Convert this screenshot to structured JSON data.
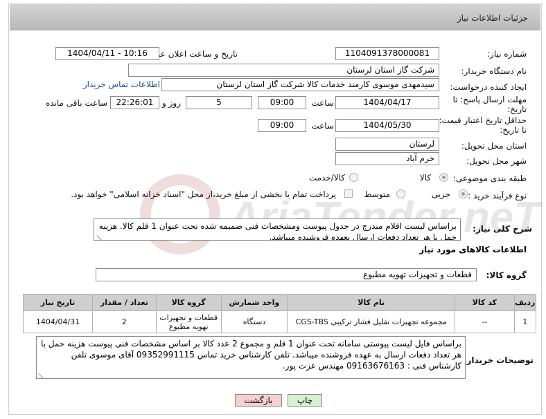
{
  "header": {
    "title": "جزئیات اطلاعات نیاز"
  },
  "form": {
    "need_number_label": "شماره نیاز:",
    "need_number": "1104091378000081",
    "announce_label": "تاریخ و ساعت اعلان عمومی:",
    "announce_value": "1404/04/11 - 10:16",
    "buyer_org_label": "نام دستگاه خریدار:",
    "buyer_org": "شرکت گاز استان لرستان",
    "requester_label": "ایجاد کننده درخواست:",
    "requester": "سیدمهدی موسوی کارمند خدمات کالا شرکت گاز استان لرستان",
    "buyer_contact_link": "اطلاعات تماس خریدار",
    "reply_deadline_label_1": "مهلت ارسال پاسخ: تا",
    "reply_deadline_label_2": "تاریخ:",
    "reply_date": "1404/04/17",
    "time_label": "ساعت",
    "reply_time": "09:00",
    "days_value": "5",
    "days_label": "روز و",
    "remaining_time": "22:26:01",
    "remaining_label": "ساعت باقی مانده",
    "price_validity_label_1": "حداقل تاریخ اعتبار قیمت:",
    "price_validity_label_2": "تا تاریخ:",
    "price_date": "1404/05/30",
    "price_time": "09:00",
    "province_label": "استان محل تحویل:",
    "province": "لرستان",
    "city_label": "شهر محل تحویل:",
    "city": "خرم آباد",
    "category_label": "طبقه بندی موضوعی:",
    "category_options": [
      "کالا",
      "کالا/خدمت"
    ],
    "process_label": "نوع فرآیند خرید :",
    "process_options": [
      "جزیی",
      "متوسط"
    ],
    "payment_note": "پرداخت تمام یا بخشی از مبلغ خرید،از محل \"اسناد خزانه اسلامی\" خواهد بود."
  },
  "summary": {
    "label": "شرح کلی نیاز:",
    "text": "براساس لیست اقلام مندرج در جدول پیوست ومشخصات فنی ضمیمه شده تحت عنوان 1 قلم کالا. هزینه حمل با هر تعداد دفعات ارسال بعهده فروشنده میباشد."
  },
  "goods": {
    "section_title": "اطلاعات کالاهای مورد نیاز",
    "group_label": "گروه کالا:",
    "group_value": "قطعات و تجهیزات تهویه مطبوع",
    "columns": [
      "ردیف",
      "کد کالا",
      "نام کالا",
      "واحد شمارش",
      "گروه کالا",
      "تعداد / مقدار",
      "تاریخ نیاز"
    ],
    "rows": [
      [
        "1",
        "--",
        "مجموعه تجهیزات تقلیل فشار ترکیبی CGS-TBS",
        "دستگاه",
        "قطعات و تجهیزات تهویه مطبوع",
        "2",
        "1404/04/31"
      ]
    ]
  },
  "buyer_notes": {
    "label": "توضیحات خریدار:",
    "text": "براساس  فایل لیست پیوستی سامانه تحت عنوان 1 قلم و مجموع 2 عدد کالا بر اساس مشخصات فنی پیوست هزینه حمل با هر تعداد دفعات ارسال به عهده فروشنده میباشد. تلفن کارشناس خرید تماس 09352991115 آقای موسوی تلفن کارشناس فنی : 09163676163 مهندس عزت پور."
  },
  "buttons": {
    "print": "چاپ",
    "back": "بازگشت"
  },
  "watermark": {
    "text": "AriaTender.neT"
  },
  "colors": {
    "link": "#1a4fa0",
    "back_button_bg": "#f5d0d0",
    "print_button_bg": "#d6f0d2"
  }
}
